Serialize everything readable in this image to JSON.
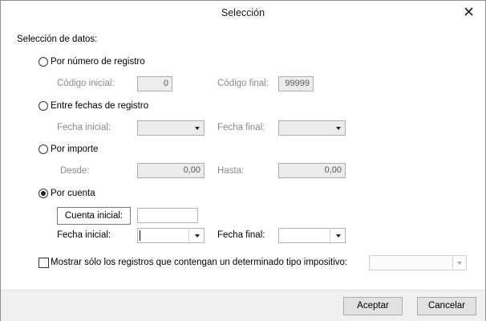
{
  "window": {
    "title": "Selección"
  },
  "section_title": "Selección de datos:",
  "options": {
    "registro": {
      "label": "Por número de registro",
      "start_label": "Código inicial:",
      "start_value": "0",
      "end_label": "Código final:",
      "end_value": "99999"
    },
    "fechas": {
      "label": "Entre fechas de registro",
      "start_label": "Fecha inicial:",
      "end_label": "Fecha final:"
    },
    "importe": {
      "label": "Por importe",
      "start_label": "Desde:",
      "start_value": "0,00",
      "end_label": "Hasta:",
      "end_value": "0,00"
    },
    "cuenta": {
      "label": "Por cuenta",
      "selected": true,
      "button_label": "Cuenta inicial:",
      "start_label": "Fecha inicial:",
      "end_label": "Fecha final:"
    }
  },
  "filter_checkbox": {
    "label": "Mostrar sólo los registros que contengan un determinado tipo impositivo:",
    "checked": false
  },
  "footer": {
    "accept_label": "Aceptar",
    "cancel_label": "Cancelar"
  }
}
